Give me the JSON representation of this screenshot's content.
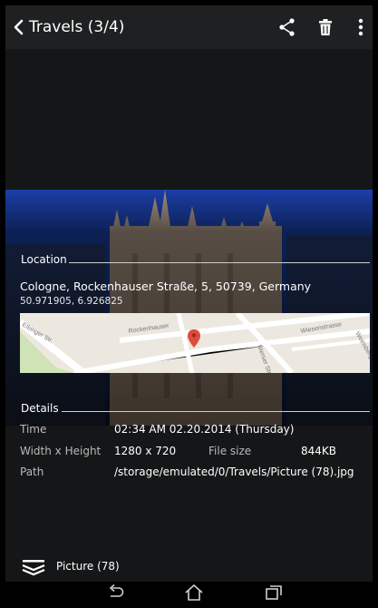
{
  "appbar": {
    "title": "Travels (3/4)",
    "icons": [
      "back-arrow-icon",
      "share-icon",
      "trash-icon",
      "overflow-menu-icon"
    ]
  },
  "location": {
    "heading": "Location",
    "address": "Cologne, Rockenhauser Straße, 5, 50739, Germany",
    "coordinates": "50.971905, 6.926825",
    "map": {
      "street_labels": [
        "Rockenhauser",
        "Elbinger Str.",
        "Wiesenstrasse",
        "Nierser Str.",
        "Weinsberg"
      ],
      "marker_color": "#e04a3f"
    }
  },
  "details": {
    "heading": "Details",
    "rows": {
      "time": {
        "label": "Time",
        "value": "02:34 AM 02.20.2014 (Thursday)"
      },
      "dimensions": {
        "label": "Width x Height",
        "value": "1280 x 720"
      },
      "filesize": {
        "label": "File size",
        "value": "844KB"
      },
      "path": {
        "label": "Path",
        "value": "/storage/emulated/0/Travels/Picture (78).jpg"
      }
    }
  },
  "bottom": {
    "picture_name": "Picture (78)",
    "nav_icons": [
      "nav-back-icon",
      "nav-home-icon",
      "nav-recent-apps-icon"
    ]
  },
  "colors": {
    "sky_top": "#1c3fa8",
    "sky_bottom": "#0e2a78",
    "background": "#151617",
    "appbar": "#1f2021"
  }
}
